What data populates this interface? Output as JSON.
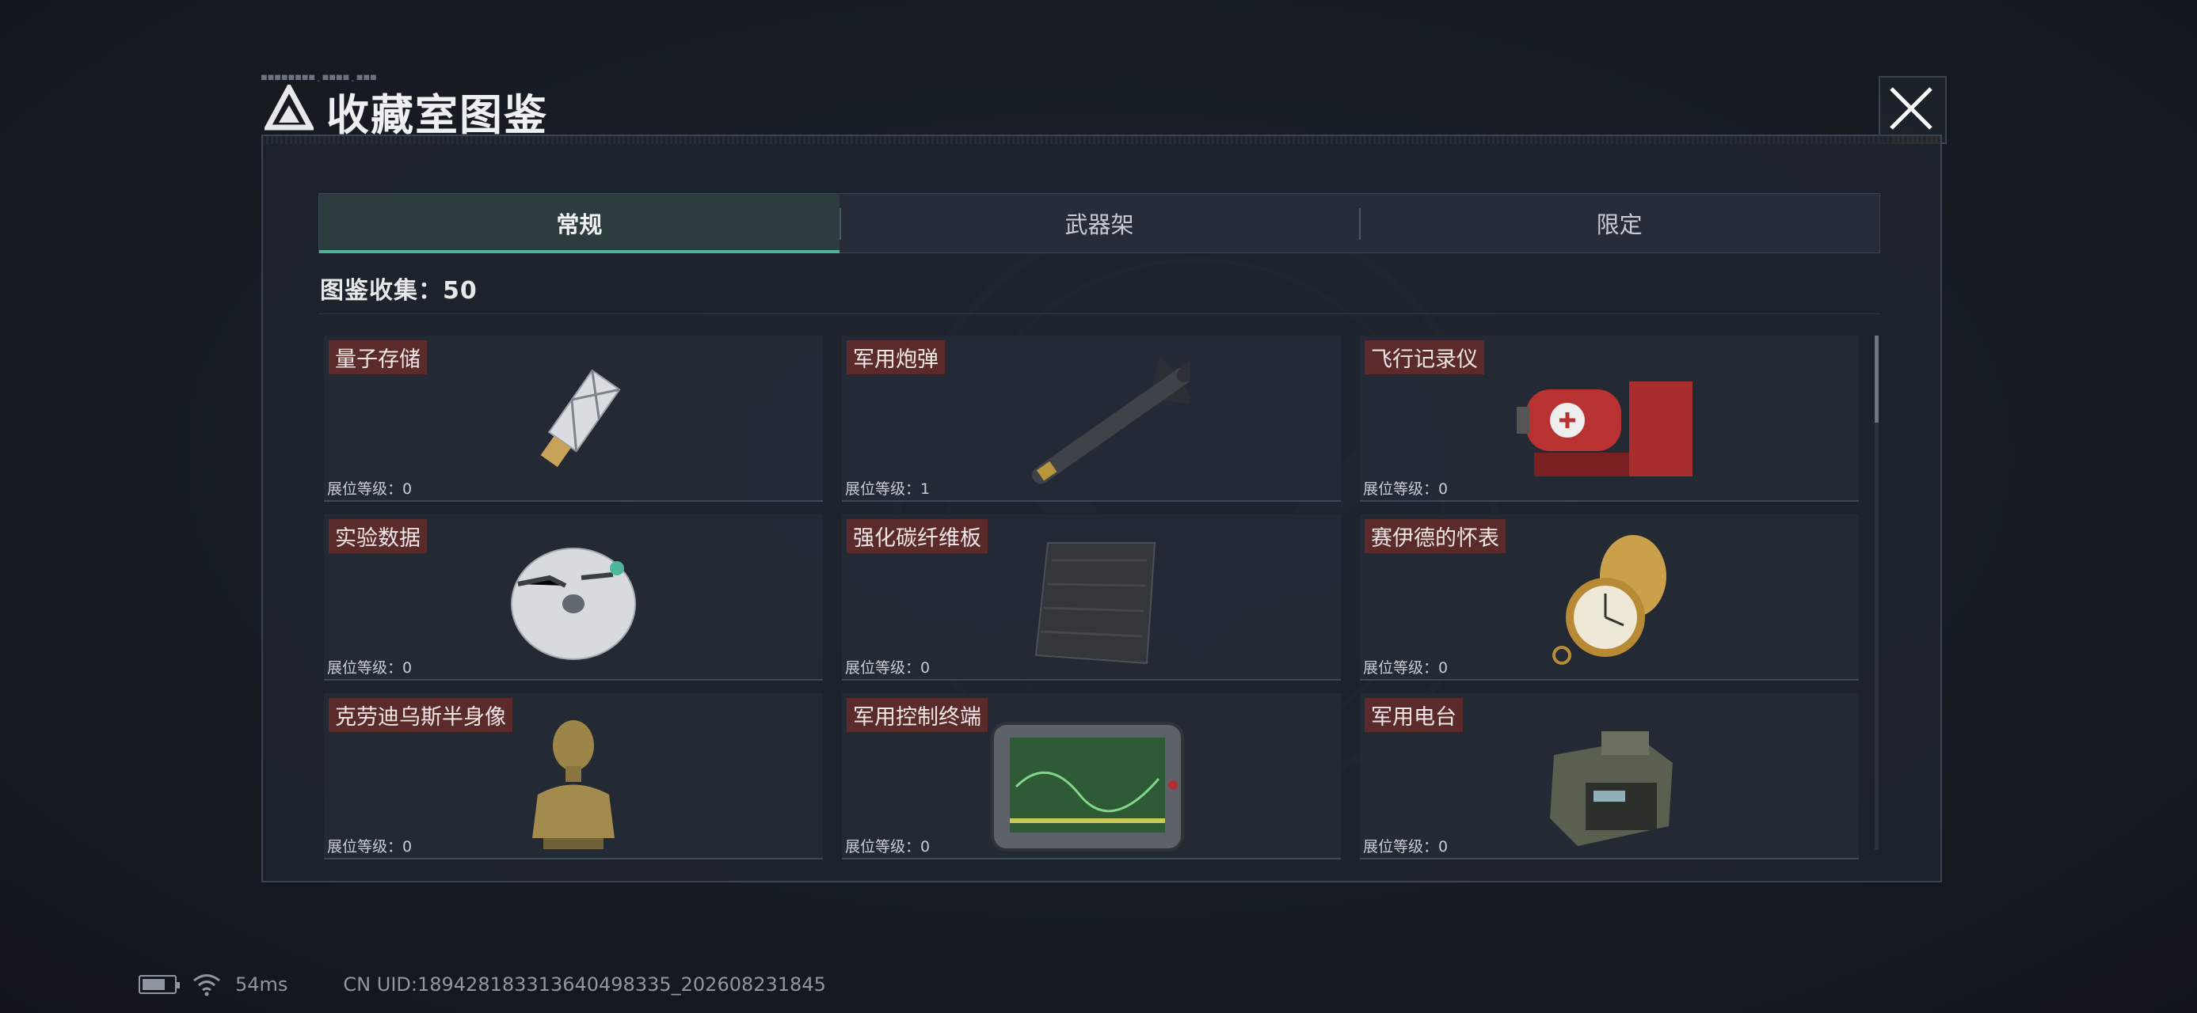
{
  "header": {
    "tiny_text": "▀▀▀▀▀▀▀▀-▀▀▀▀-▀▀▀",
    "title": "收藏室图鉴",
    "logo_icon": "triangle-logo-icon",
    "close_icon": "close-icon"
  },
  "tabs": [
    {
      "label": "常规",
      "active": true
    },
    {
      "label": "武器架",
      "active": false
    },
    {
      "label": "限定",
      "active": false
    }
  ],
  "collection": {
    "label": "图鉴收集：50"
  },
  "items": [
    {
      "name": "量子存储",
      "level": "展位等级：0",
      "icon": "usb-drive-icon"
    },
    {
      "name": "军用炮弹",
      "level": "展位等级：1",
      "icon": "missile-icon"
    },
    {
      "name": "飞行记录仪",
      "level": "展位等级：0",
      "icon": "flight-recorder-icon"
    },
    {
      "name": "实验数据",
      "level": "展位等级：0",
      "icon": "disc-icon"
    },
    {
      "name": "强化碳纤维板",
      "level": "展位等级：0",
      "icon": "carbon-plate-icon"
    },
    {
      "name": "赛伊德的怀表",
      "level": "展位等级：0",
      "icon": "pocket-watch-icon"
    },
    {
      "name": "克劳迪乌斯半身像",
      "level": "展位等级：0",
      "icon": "bust-icon"
    },
    {
      "name": "军用控制终端",
      "level": "展位等级：0",
      "icon": "control-terminal-icon"
    },
    {
      "name": "军用电台",
      "level": "展位等级：0",
      "icon": "radio-icon"
    }
  ],
  "status_bar": {
    "ping": "54ms",
    "uid": "CN UID:18942818331364049833​5_202608231845",
    "battery_icon": "battery-icon",
    "wifi_icon": "wifi-icon"
  },
  "colors": {
    "accent": "#4fb59a",
    "name_tag": "#5b2b2b",
    "panel": "#1e242e"
  }
}
